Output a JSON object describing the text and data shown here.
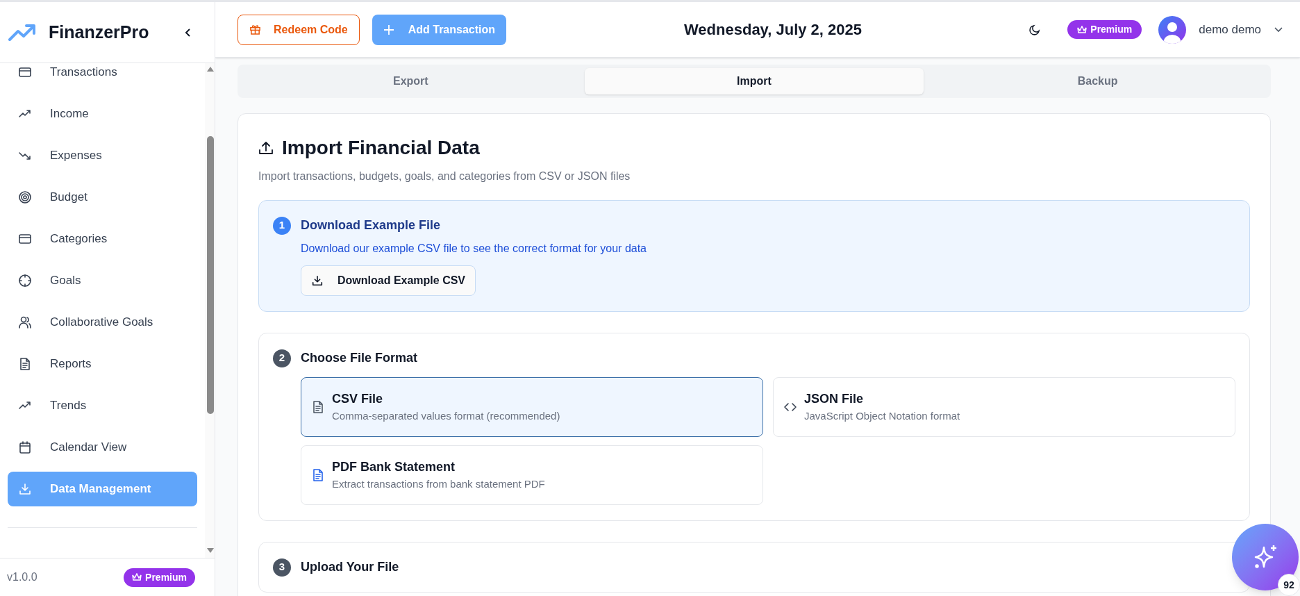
{
  "app": {
    "name": "FinanzerPro"
  },
  "sidebar": {
    "items": [
      {
        "label": "Transactions",
        "selected": false
      },
      {
        "label": "Income",
        "selected": false
      },
      {
        "label": "Expenses",
        "selected": false
      },
      {
        "label": "Budget",
        "selected": false
      },
      {
        "label": "Categories",
        "selected": false
      },
      {
        "label": "Goals",
        "selected": false
      },
      {
        "label": "Collaborative Goals",
        "selected": false
      },
      {
        "label": "Reports",
        "selected": false
      },
      {
        "label": "Trends",
        "selected": false
      },
      {
        "label": "Calendar View",
        "selected": false
      },
      {
        "label": "Data Management",
        "selected": true
      }
    ],
    "version": "v1.0.0",
    "plan_badge": "Premium"
  },
  "header": {
    "redeem_button": "Redeem Code",
    "add_button": "Add Transaction",
    "date": "Wednesday, July 2, 2025",
    "plan_badge": "Premium",
    "user_name": "demo demo"
  },
  "tabs": [
    {
      "label": "Export",
      "selected": false
    },
    {
      "label": "Import",
      "selected": true
    },
    {
      "label": "Backup",
      "selected": false
    }
  ],
  "import": {
    "title": "Import Financial Data",
    "subtitle": "Import transactions, budgets, goals, and categories from CSV or JSON files",
    "steps": [
      {
        "number": "1",
        "title": "Download Example File",
        "active": true,
        "description": "Download our example CSV file to see the correct format for your data",
        "button": "Download Example CSV"
      },
      {
        "number": "2",
        "title": "Choose File Format",
        "active": false,
        "formats": [
          {
            "title": "CSV File",
            "description": "Comma-separated values format (recommended)",
            "selected": true
          },
          {
            "title": "JSON File",
            "description": "JavaScript Object Notation format",
            "selected": false
          },
          {
            "title": "PDF Bank Statement",
            "description": "Extract transactions from bank statement PDF",
            "selected": false
          }
        ]
      },
      {
        "number": "3",
        "title": "Upload Your File",
        "active": false
      }
    ]
  },
  "assistant": {
    "badge": "92"
  }
}
